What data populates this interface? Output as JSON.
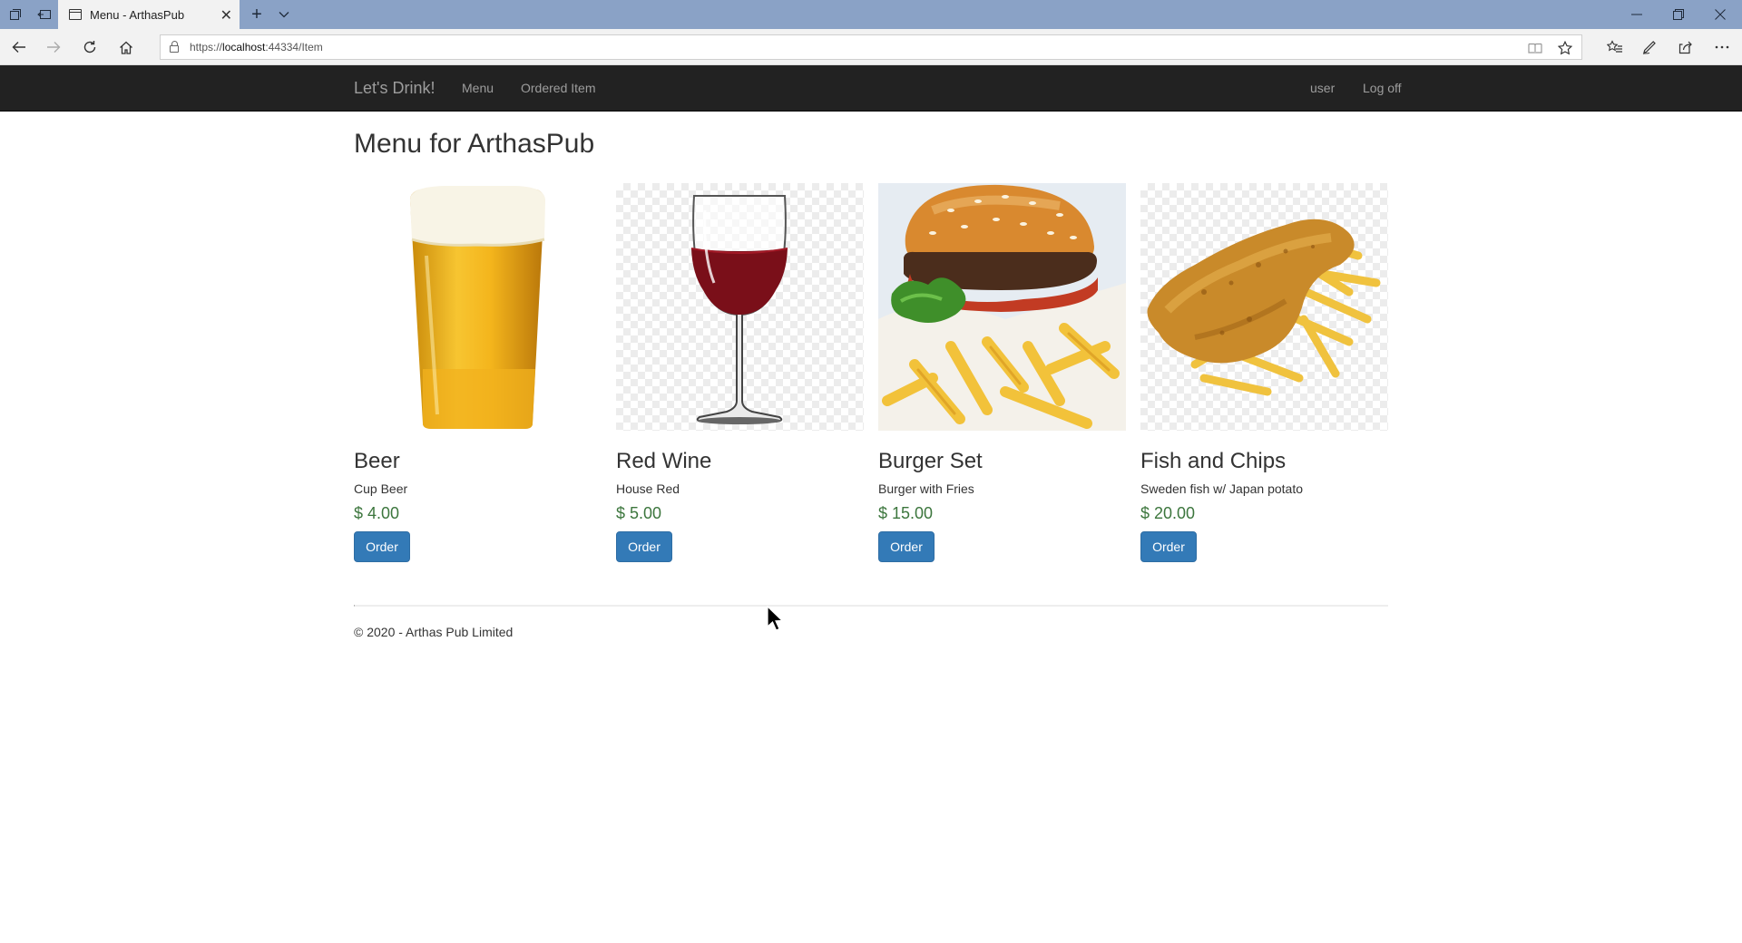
{
  "browser": {
    "tab_title": "Menu - ArthasPub",
    "url_prefix": "https://",
    "url_host": "localhost",
    "url_rest": ":44334/Item",
    "new_tab_glyph": "+",
    "close_glyph": "✕",
    "icons": [
      "tab-actions-icon",
      "set-aside-icon",
      "page-icon",
      "close-icon",
      "plus-icon",
      "chevron-down-icon",
      "minimize-icon",
      "restore-icon",
      "close-window-icon",
      "back-icon",
      "forward-icon",
      "refresh-icon",
      "home-icon",
      "lock-icon",
      "reading-view-icon",
      "star-icon",
      "favorites-icon",
      "pen-icon",
      "share-icon",
      "more-icon"
    ]
  },
  "site": {
    "brand": "Let's Drink!",
    "nav_menu": "Menu",
    "nav_ordered": "Ordered Item",
    "nav_user": "user",
    "nav_logoff": "Log off"
  },
  "page": {
    "title": "Menu for ArthasPub"
  },
  "items": [
    {
      "name": "Beer",
      "description": "Cup Beer",
      "price": "$ 4.00",
      "button": "Order",
      "image": "beer-glass-image"
    },
    {
      "name": "Red Wine",
      "description": "House Red",
      "price": "$ 5.00",
      "button": "Order",
      "image": "wine-glass-image"
    },
    {
      "name": "Burger Set",
      "description": "Burger with Fries",
      "price": "$ 15.00",
      "button": "Order",
      "image": "burger-image"
    },
    {
      "name": "Fish and Chips",
      "description": "Sweden fish w/ Japan potato",
      "price": "$ 20.00",
      "button": "Order",
      "image": "fish-and-chips-image"
    }
  ],
  "footer": {
    "text": "© 2020 - Arthas Pub Limited"
  },
  "colors": {
    "navbar": "#222222",
    "nav_text": "#9d9d9d",
    "price": "#3c763d",
    "button": "#337ab7",
    "titlebar": "#8aa2c6"
  }
}
